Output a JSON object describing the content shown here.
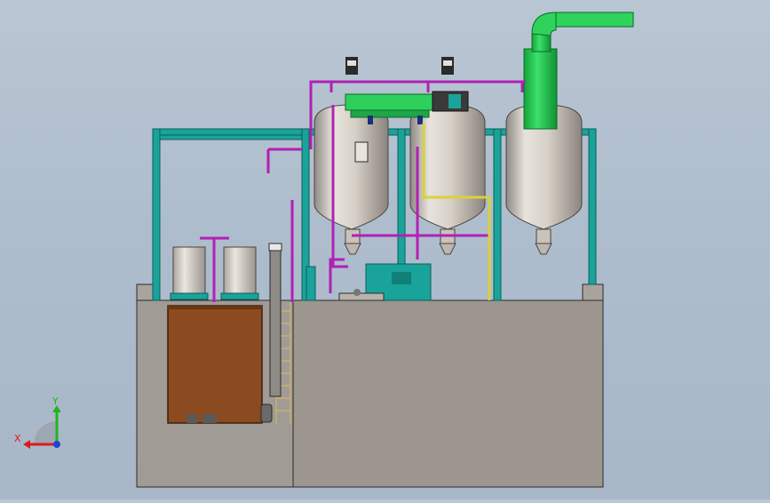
{
  "triad": {
    "x_label": "X",
    "y_label": "Y",
    "x_color": "#d81b1b",
    "y_color": "#1fb51f",
    "z_color": "#2140d8"
  },
  "colors": {
    "frame": "#1aa39a",
    "tank": "#d9d3ca",
    "exhaust_pipe": "#22c24c",
    "purge_line": "#b021b5",
    "yellow_line": "#d8d23a",
    "sump": "#8b4a20",
    "concrete": "#9b9690"
  },
  "diagram": {
    "view": "front",
    "process_tanks": 3,
    "small_tanks": 2
  }
}
